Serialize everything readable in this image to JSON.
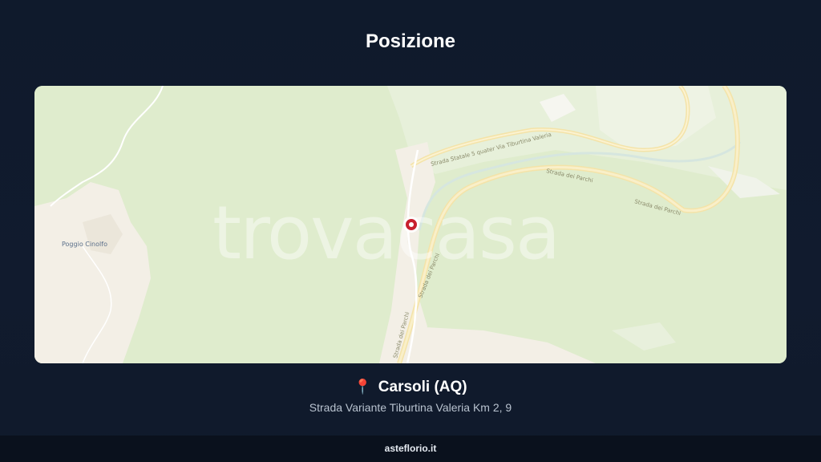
{
  "header": {
    "title": "Posizione"
  },
  "map": {
    "watermark": "trovacasa",
    "place_label": "Poggio Cinolfo",
    "road_labels": [
      "Strada Statale 5 quater Via Tiburtina Valeria",
      "Strada dei Parchi",
      "Strada dei Parchi",
      "Strada dei Parchi",
      "Strada dei Parchi"
    ],
    "colors": {
      "land": "#dfeccd",
      "town": "#f5f1ea",
      "road": "#f6e7b1",
      "marker": "#c8202e"
    },
    "marker_icon": "map-pin-icon"
  },
  "location": {
    "pin_icon": "📍",
    "city": "Carsoli (AQ)",
    "address": "Strada Variante Tiburtina Valeria Km 2, 9"
  },
  "footer": {
    "site": "asteflorio.it"
  }
}
